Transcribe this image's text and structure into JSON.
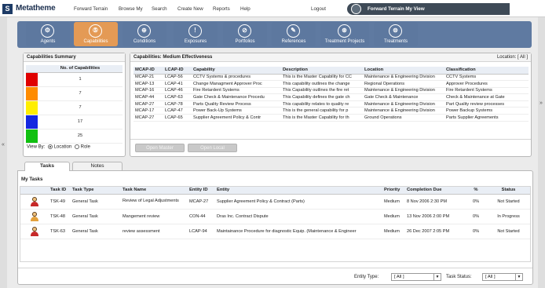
{
  "app": {
    "logo_mark": "S",
    "name": "Metatheme"
  },
  "topnav": [
    "Forward Terrain",
    "Browse My",
    "Search",
    "Create New",
    "Reports",
    "Help"
  ],
  "logout": "Logout",
  "my_view": "Forward Terrain My View",
  "rail_arrows": {
    "left": "«",
    "right": "»"
  },
  "icons": [
    {
      "label": "Agents",
      "glyph": "⚙"
    },
    {
      "label": "Capabilities",
      "glyph": "⑤"
    },
    {
      "label": "Conditions",
      "glyph": "⊕"
    },
    {
      "label": "Exposures",
      "glyph": "!"
    },
    {
      "label": "Portfolios",
      "glyph": "⊘"
    },
    {
      "label": "References",
      "glyph": "✎"
    },
    {
      "label": "Treatment Projects",
      "glyph": "⊛"
    },
    {
      "label": "Treatments",
      "glyph": "⊜"
    }
  ],
  "summary": {
    "title": "Capabilities Summary",
    "col": "No. of Capabilities",
    "rows": [
      {
        "color": "#e00000",
        "count": "1"
      },
      {
        "color": "#ff8c00",
        "count": "7"
      },
      {
        "color": "#ffee00",
        "count": "7"
      },
      {
        "color": "#1428e0",
        "count": "17"
      },
      {
        "color": "#10c010",
        "count": "25"
      }
    ],
    "view_by": "View By:",
    "opt_location": "Location",
    "opt_role": "Role"
  },
  "caps": {
    "title": "Capabilities: Medium Effectiveness",
    "location_label": "Location: [ All ]",
    "headers": [
      "MCAP-ID",
      "LCAP-ID",
      "Capability",
      "Description",
      "Location",
      "Classification"
    ],
    "rows": [
      [
        "MCAP-21",
        "LCAP-56",
        "CCTV Systems & procedures",
        "This is the Master Capability for CC",
        "Maintenance & Engineering Division",
        "CCTV Systems"
      ],
      [
        "MCAP-13",
        "LCAP-41",
        "Change Managment Approver Proc",
        "This capability outlines the change",
        "Regional Operations",
        "Approver Procedures"
      ],
      [
        "MCAP-16",
        "LCAP-46",
        "Fire Retardent Systems",
        "This Capability outlines the fire ret",
        "Maintenance & Engineering Division",
        "Fire Retardent Systems"
      ],
      [
        "MCAP-44",
        "LCAP-63",
        "Gate Check & Maintenance Procedu",
        "This Capability defines the gate ch",
        "Gate Check & Maintenance",
        "Check & Maintenance at Gate"
      ],
      [
        "MCAP-27",
        "LCAP-78",
        "Parts Quality Review Process",
        "This capability relates to quality re",
        "Maintenance & Engineering Division",
        "Part Quality review processes"
      ],
      [
        "MCAP-17",
        "LCAP-47",
        "Power Back-Up Systems",
        "This is the general capability for p",
        "Maintenance & Engineering Division",
        "Power Backup Systems"
      ],
      [
        "MCAP-27",
        "LCAP-65",
        "Supplier Agreement Policy & Contr",
        "This is the Master Capability for th",
        "Ground Operations",
        "Parts Supplier Agreements"
      ]
    ],
    "btn_master": "Open Master",
    "btn_local": "Open Local"
  },
  "tabs": {
    "tasks": "Tasks",
    "notes": "Notes"
  },
  "tasks": {
    "title": "My Tasks",
    "headers": [
      "Task ID",
      "Task Type",
      "Task Name",
      "Entity ID",
      "Entity",
      "Priority",
      "Completion Due",
      "%",
      "Status"
    ],
    "rows": [
      [
        "TSK-49",
        "General Task",
        "Review of Legal Adjustments",
        "MCAP-27",
        "Supplier Agreement Policy & Contract (Parts)",
        "Medium",
        "8 Nov 2006 2:30 PM",
        "0%",
        "Not Started"
      ],
      [
        "TSK-48",
        "General Task",
        "Mangement review",
        "CON-44",
        "Dras Inc. Contract Dispute",
        "Medium",
        "13 Nov 2006 2:00 PM",
        "0%",
        "In Progress"
      ],
      [
        "TSK-63",
        "General Task",
        "review assessment",
        "LCAP-94",
        "Maintainance Procedure for diagnostic Equip. (Maintenance & Engineer",
        "Medium",
        "26 Dec 2007 2:05 PM",
        "0%",
        "Not Started"
      ]
    ],
    "entity_type_label": "Entity Type:",
    "entity_type_value": "[ All ]",
    "task_status_label": "Task Status:",
    "task_status_value": "[ All ]"
  }
}
